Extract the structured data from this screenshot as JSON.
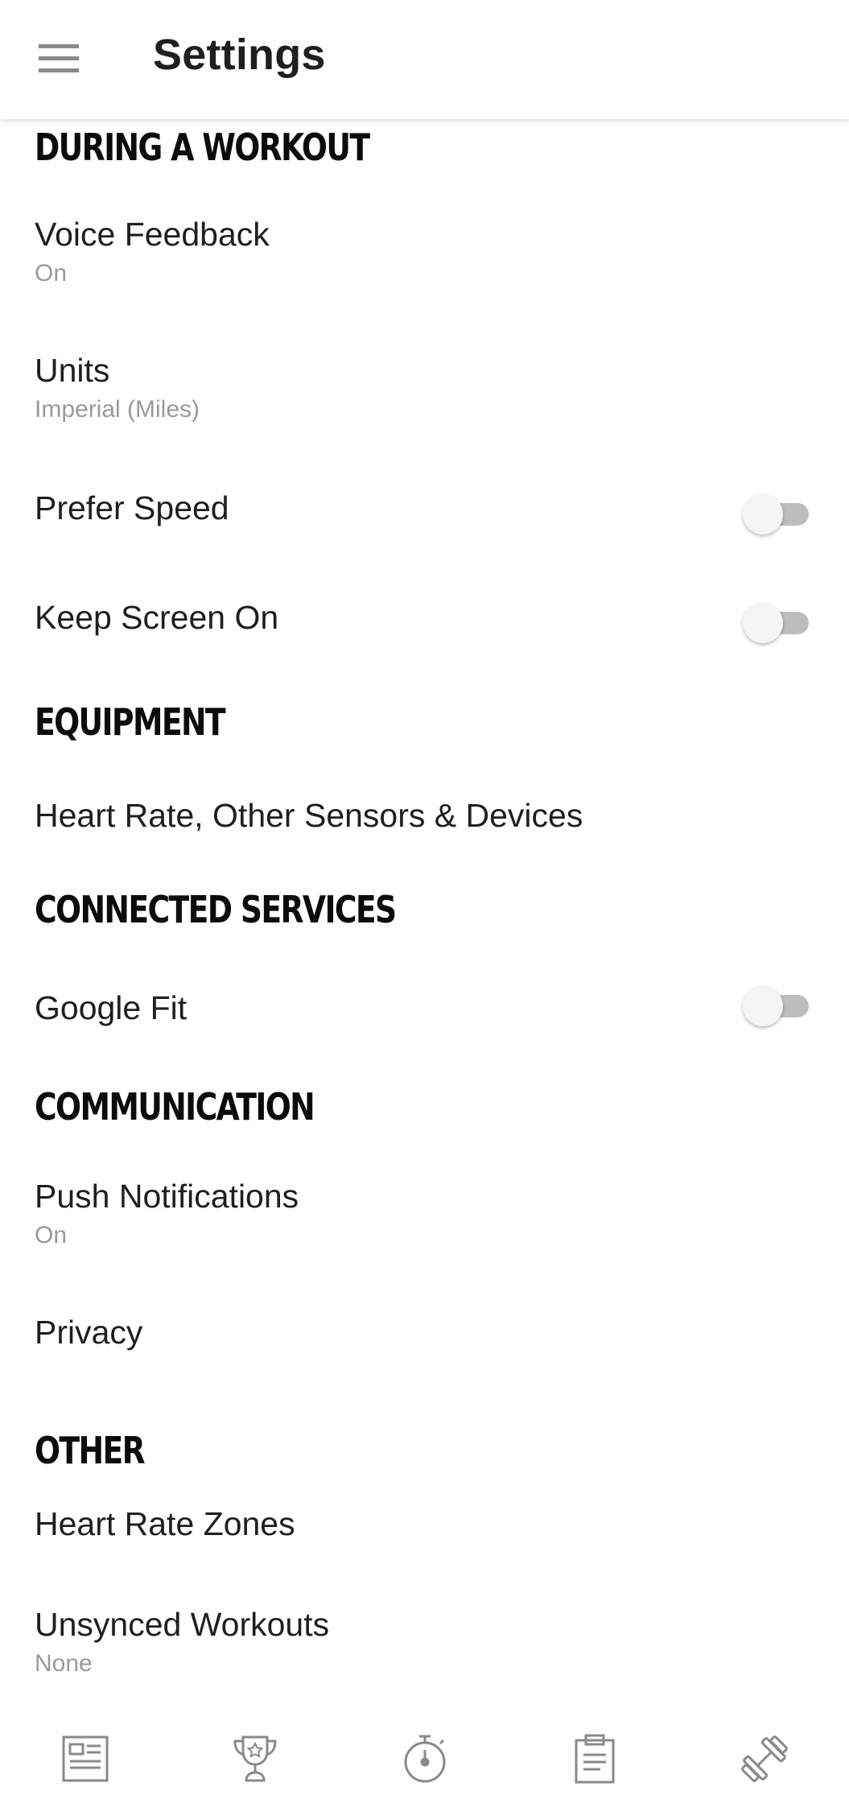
{
  "appbar": {
    "title": "Settings",
    "menu_icon": "hamburger-menu-icon"
  },
  "sections": {
    "during_workout": {
      "header": "DURING A WORKOUT",
      "voice_feedback": {
        "title": "Voice Feedback",
        "value": "On"
      },
      "units": {
        "title": "Units",
        "value": "Imperial (Miles)"
      },
      "prefer_speed": {
        "title": "Prefer Speed",
        "enabled": false
      },
      "keep_screen_on": {
        "title": "Keep Screen On",
        "enabled": false
      }
    },
    "equipment": {
      "header": "EQUIPMENT",
      "sensors": {
        "title": "Heart Rate, Other Sensors & Devices"
      }
    },
    "connected_services": {
      "header": "CONNECTED SERVICES",
      "google_fit": {
        "title": "Google Fit",
        "enabled": false
      }
    },
    "communication": {
      "header": "COMMUNICATION",
      "push_notifications": {
        "title": "Push Notifications",
        "value": "On"
      },
      "privacy": {
        "title": "Privacy"
      }
    },
    "other": {
      "header": "OTHER",
      "heart_rate_zones": {
        "title": "Heart Rate Zones"
      },
      "unsynced_workouts": {
        "title": "Unsynced Workouts",
        "value": "None"
      }
    }
  },
  "bottom_nav": {
    "items": [
      "feed-icon",
      "trophy-icon",
      "stopwatch-icon",
      "clipboard-icon",
      "dumbbell-icon"
    ]
  },
  "colors": {
    "background": "#ffffff",
    "text_primary": "#1f1f1f",
    "text_secondary": "#9a9a9a",
    "toggle_track_off": "#bdbdbd",
    "toggle_thumb_off": "#f5f5f5",
    "icon_gray": "#8a8a8a"
  }
}
